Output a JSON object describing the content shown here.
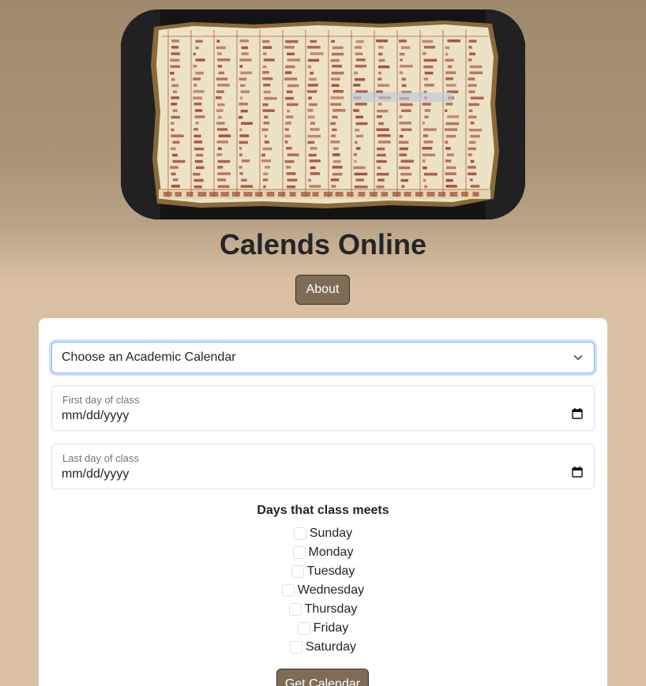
{
  "app": {
    "title": "Calends Online",
    "about_label": "About"
  },
  "hero": {
    "image_alt": "Fasti Antiates Maiores Roman calendar fresco"
  },
  "form": {
    "calendar_select": {
      "selected": "Choose an Academic Calendar"
    },
    "first_day": {
      "label": "First day of class",
      "value": "mm/dd/yyyy"
    },
    "last_day": {
      "label": "Last day of class",
      "value": "mm/dd/yyyy"
    },
    "days_heading": "Days that class meets",
    "days": [
      {
        "label": "Sunday",
        "checked": false
      },
      {
        "label": "Monday",
        "checked": false
      },
      {
        "label": "Tuesday",
        "checked": false
      },
      {
        "label": "Wednesday",
        "checked": false
      },
      {
        "label": "Thursday",
        "checked": false
      },
      {
        "label": "Friday",
        "checked": false
      },
      {
        "label": "Saturday",
        "checked": false
      }
    ],
    "submit_label": "Get Calendar"
  },
  "icons": {
    "select": "chevron-down-icon",
    "date": "calendar-icon"
  },
  "colors": {
    "page_background": "#d9c0a2",
    "button_background": "#7e6c56",
    "focus_border": "#86b7fe",
    "title_text": "#23252a"
  }
}
